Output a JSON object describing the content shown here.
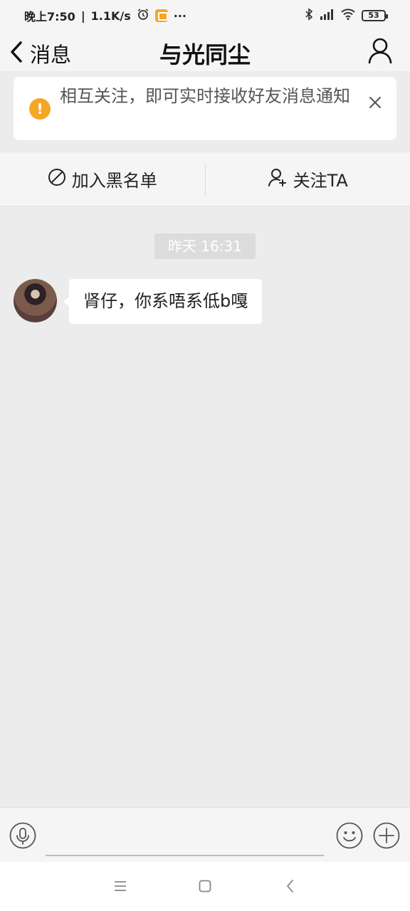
{
  "status_bar": {
    "time": "晚上7:50",
    "speed": "1.1K/s",
    "more": "···",
    "battery": "53"
  },
  "nav": {
    "back_label": "消息",
    "title": "与光同尘"
  },
  "notice": {
    "text": "相互关注，即可实时接收好友消息通知"
  },
  "actions": {
    "block_label": "加入黑名单",
    "follow_label": "关注TA"
  },
  "chat": {
    "timestamp": "昨天 16:31",
    "messages": [
      {
        "text": "肾仔，你系唔系低b嘎"
      }
    ]
  },
  "colors": {
    "notice_icon": "#f5a623",
    "background": "#ececec",
    "bubble": "#ffffff"
  },
  "icons": {
    "back": "chevron-left-icon",
    "profile": "user-icon",
    "notice": "exclamation-icon",
    "close": "close-icon",
    "block": "prohibit-icon",
    "follow": "user-plus-icon",
    "voice": "microphone-icon",
    "emoji": "smiley-icon",
    "plus": "plus-icon"
  }
}
